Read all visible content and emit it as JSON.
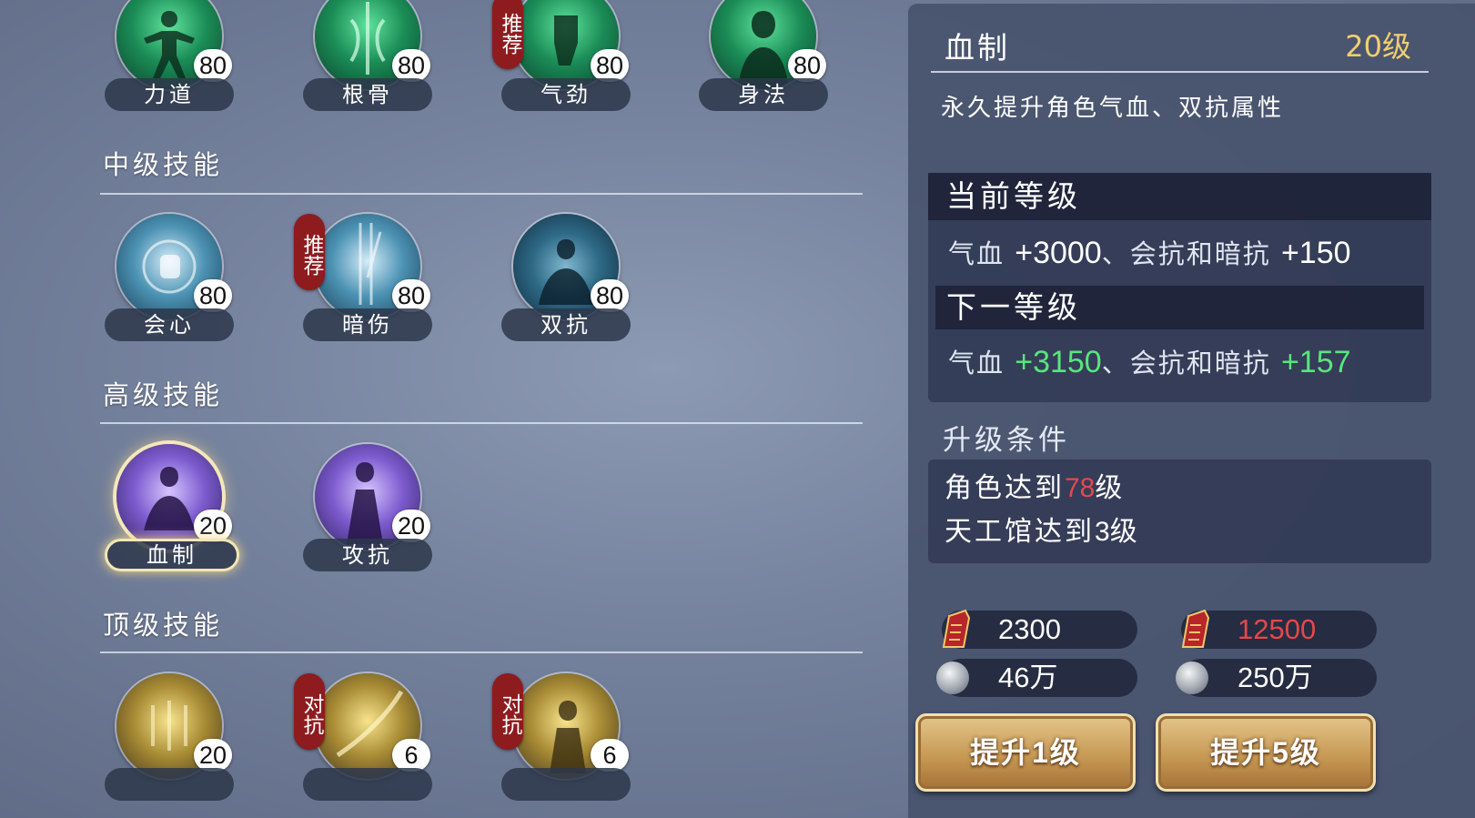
{
  "skills": {
    "row1": [
      {
        "name": "力道",
        "level": "80"
      },
      {
        "name": "根骨",
        "level": "80"
      },
      {
        "name": "气劲",
        "level": "80",
        "tag": "推荐"
      },
      {
        "name": "身法",
        "level": "80"
      }
    ],
    "mid_title": "中级技能",
    "row2": [
      {
        "name": "会心",
        "level": "80"
      },
      {
        "name": "暗伤",
        "level": "80",
        "tag": "推荐"
      },
      {
        "name": "双抗",
        "level": "80"
      }
    ],
    "high_title": "高级技能",
    "row3": [
      {
        "name": "血制",
        "level": "20",
        "selected": true
      },
      {
        "name": "攻抗",
        "level": "20"
      }
    ],
    "top_title": "顶级技能",
    "row4": [
      {
        "name": "",
        "level": "20"
      },
      {
        "name": "",
        "level": "6",
        "tag": "对抗"
      },
      {
        "name": "",
        "level": "6",
        "tag": "对抗"
      }
    ]
  },
  "detail": {
    "title": "血制",
    "level": "20级",
    "desc": "永久提升角色气血、双抗属性",
    "current_label": "当前等级",
    "current_stat": {
      "t1": "气血 ",
      "v1": "+3000",
      "t2": "、会抗和暗抗 ",
      "v2": "+150"
    },
    "next_label": "下一等级",
    "next_stat": {
      "t1": "气血 ",
      "v1": "+3150",
      "t2": "、会抗和暗抗 ",
      "v2": "+157"
    },
    "cond_title": "升级条件",
    "cond1": {
      "pre": "角色达到",
      "num": "78",
      "post": "级"
    },
    "cond2": {
      "pre": "天工馆达到",
      "num": "3",
      "post": "级"
    }
  },
  "costs": {
    "one": {
      "token": "2300",
      "coin": "46万"
    },
    "five": {
      "token": "12500",
      "coin": "250万"
    }
  },
  "buttons": {
    "one": {
      "pre": "提升",
      "num": "1",
      "post": "级"
    },
    "five": {
      "pre": "提升",
      "num": "5",
      "post": "级"
    }
  },
  "colors": {
    "accent_gold": "#f0cf6e",
    "green": "#57e67d",
    "red": "#e5484b"
  }
}
